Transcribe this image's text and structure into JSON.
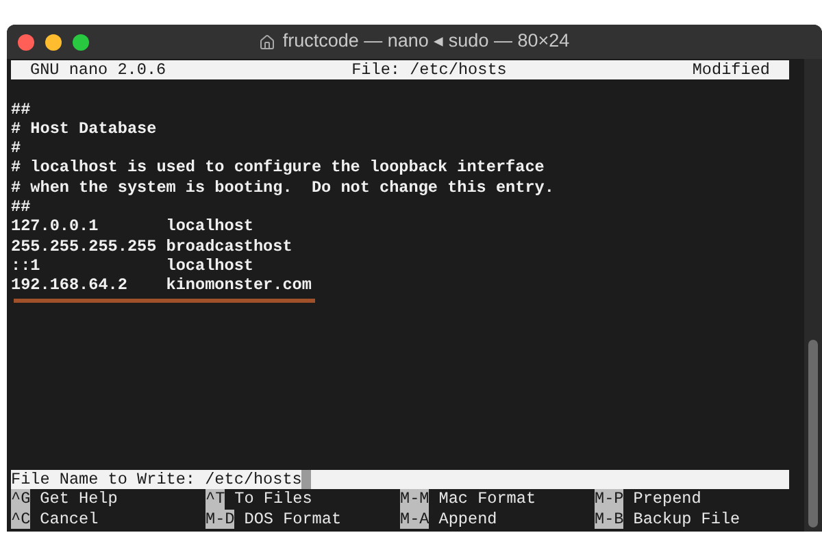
{
  "window": {
    "title": "fructcode — nano ◂ sudo — 80×24"
  },
  "header": {
    "app": "GNU nano 2.0.6",
    "file": "File: /etc/hosts",
    "status": "Modified"
  },
  "lines": [
    "##",
    "# Host Database",
    "#",
    "# localhost is used to configure the loopback interface",
    "# when the system is booting.  Do not change this entry.",
    "##",
    "127.0.0.1       localhost",
    "255.255.255.255 broadcasthost",
    "::1             localhost",
    "192.168.64.2    kinomonster.com"
  ],
  "prompt": {
    "label": "File Name to Write: /etc/hosts"
  },
  "shortcuts": [
    [
      {
        "key": "^G",
        "label": "Get Help"
      },
      {
        "key": "^T",
        "label": "To Files"
      },
      {
        "key": "M-M",
        "label": "Mac Format"
      },
      {
        "key": "M-P",
        "label": "Prepend"
      }
    ],
    [
      {
        "key": "^C",
        "label": "Cancel"
      },
      {
        "key": "M-D",
        "label": "DOS Format"
      },
      {
        "key": "M-A",
        "label": "Append"
      },
      {
        "key": "M-B",
        "label": "Backup File"
      }
    ]
  ]
}
